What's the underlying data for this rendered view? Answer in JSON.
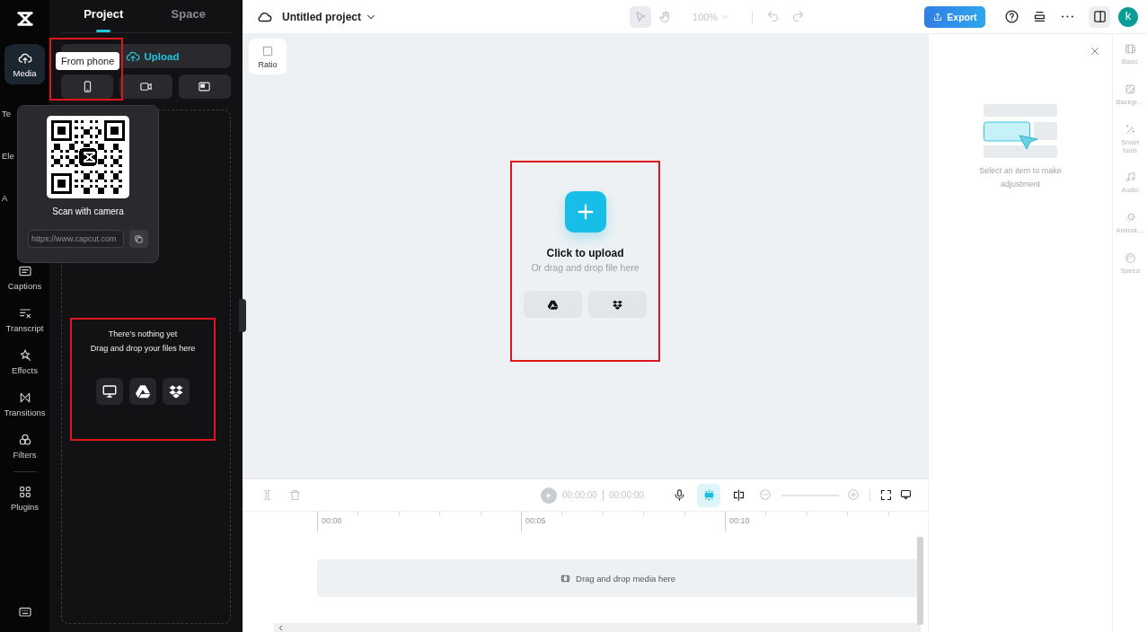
{
  "sidebar": {
    "items": [
      {
        "label": "Media",
        "kind": "full",
        "selected": true
      },
      {
        "label": "Te",
        "kind": "partial",
        "selected": false
      },
      {
        "label": "Ele",
        "kind": "partial",
        "selected": false
      },
      {
        "label": "A",
        "kind": "partial",
        "selected": false
      },
      {
        "label": "Captions",
        "kind": "full",
        "selected": false
      },
      {
        "label": "Transcript",
        "kind": "full",
        "selected": false
      },
      {
        "label": "Effects",
        "kind": "full",
        "selected": false
      },
      {
        "label": "Transitions",
        "kind": "full",
        "selected": false
      },
      {
        "label": "Filters",
        "kind": "full",
        "selected": false
      },
      {
        "label": "Plugins",
        "kind": "full",
        "selected": false
      }
    ]
  },
  "panel": {
    "tabs": [
      {
        "label": "Project",
        "selected": true
      },
      {
        "label": "Space",
        "selected": false
      }
    ],
    "upload_button": "Upload",
    "source_buttons": [
      {
        "kind": "phone",
        "highlighted": true
      },
      {
        "kind": "camera",
        "highlighted": false
      },
      {
        "kind": "screen",
        "highlighted": false
      }
    ],
    "tooltip": "From phone",
    "qr_popup": {
      "caption": "Scan with camera",
      "link": "https://www.capcut.com"
    },
    "empty_state": {
      "title": "There’s nothing yet",
      "hint": "Drag and drop your files here",
      "highlighted": true,
      "sources": [
        {
          "kind": "computer"
        },
        {
          "kind": "drive"
        },
        {
          "kind": "dropbox"
        }
      ]
    }
  },
  "topbar": {
    "project_title": "Untitled project",
    "tools": [
      {
        "kind": "select",
        "selected": true
      },
      {
        "kind": "hand",
        "selected": false
      }
    ],
    "zoom": "100%",
    "history": [
      {
        "kind": "undo",
        "disabled": true
      },
      {
        "kind": "redo",
        "disabled": true
      }
    ],
    "export": "Export",
    "avatar": "k"
  },
  "canvas": {
    "ratio": "Ratio",
    "upload": {
      "title": "Click to upload",
      "hint": "Or drag and drop file here",
      "highlighted": true,
      "sources": [
        {
          "kind": "drive"
        },
        {
          "kind": "dropbox"
        }
      ]
    }
  },
  "right_panel": {
    "message": "Select an item to make adjustment",
    "tabs": [
      {
        "label": "Basic"
      },
      {
        "label": "Backgr…"
      },
      {
        "label": "Smart tools"
      },
      {
        "label": "Audio"
      },
      {
        "label": "Animat…"
      },
      {
        "label": "Speed"
      }
    ]
  },
  "timeline": {
    "tools_left": [
      {
        "kind": "split",
        "disabled": true
      },
      {
        "kind": "delete",
        "disabled": true
      }
    ],
    "current_time": "00:00:00",
    "total_time": "00:00:00",
    "tools_right": [
      {
        "kind": "mic",
        "active": false
      },
      {
        "kind": "magnet",
        "active": true
      },
      {
        "kind": "splitter",
        "active": false
      }
    ],
    "ruler": [
      "00:00",
      "00:05",
      "00:10"
    ],
    "track_hint": "Drag and drop media here"
  }
}
